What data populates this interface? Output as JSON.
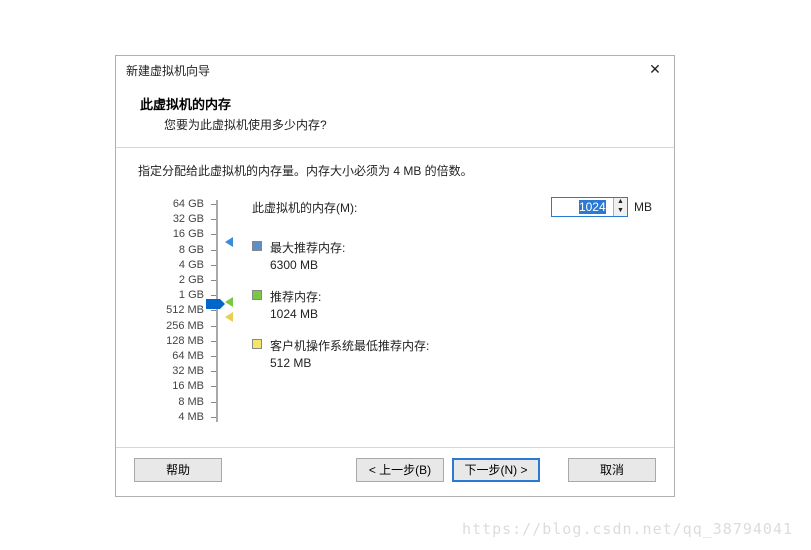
{
  "title": "新建虚拟机向导",
  "header": {
    "title": "此虚拟机的内存",
    "sub": "您要为此虚拟机使用多少内存?"
  },
  "instr": "指定分配给此虚拟机的内存量。内存大小必须为 4 MB 的倍数。",
  "slider_ticks": [
    "64 GB",
    "32 GB",
    "16 GB",
    "8 GB",
    "4 GB",
    "2 GB",
    "1 GB",
    "512 MB",
    "256 MB",
    "128 MB",
    "64 MB",
    "32 MB",
    "16 MB",
    "8 MB",
    "4 MB"
  ],
  "memory": {
    "label": "此虚拟机的内存(M):",
    "value": "1024",
    "unit": "MB"
  },
  "rec": {
    "max": {
      "label": "最大推荐内存:",
      "value": "6300 MB"
    },
    "sug": {
      "label": "推荐内存:",
      "value": "1024 MB"
    },
    "min": {
      "label": "客户机操作系统最低推荐内存:",
      "value": "512 MB"
    }
  },
  "buttons": {
    "help": "帮助",
    "back": "< 上一步(B)",
    "next": "下一步(N) >",
    "cancel": "取消"
  },
  "watermark": "https://blog.csdn.net/qq_38794041"
}
